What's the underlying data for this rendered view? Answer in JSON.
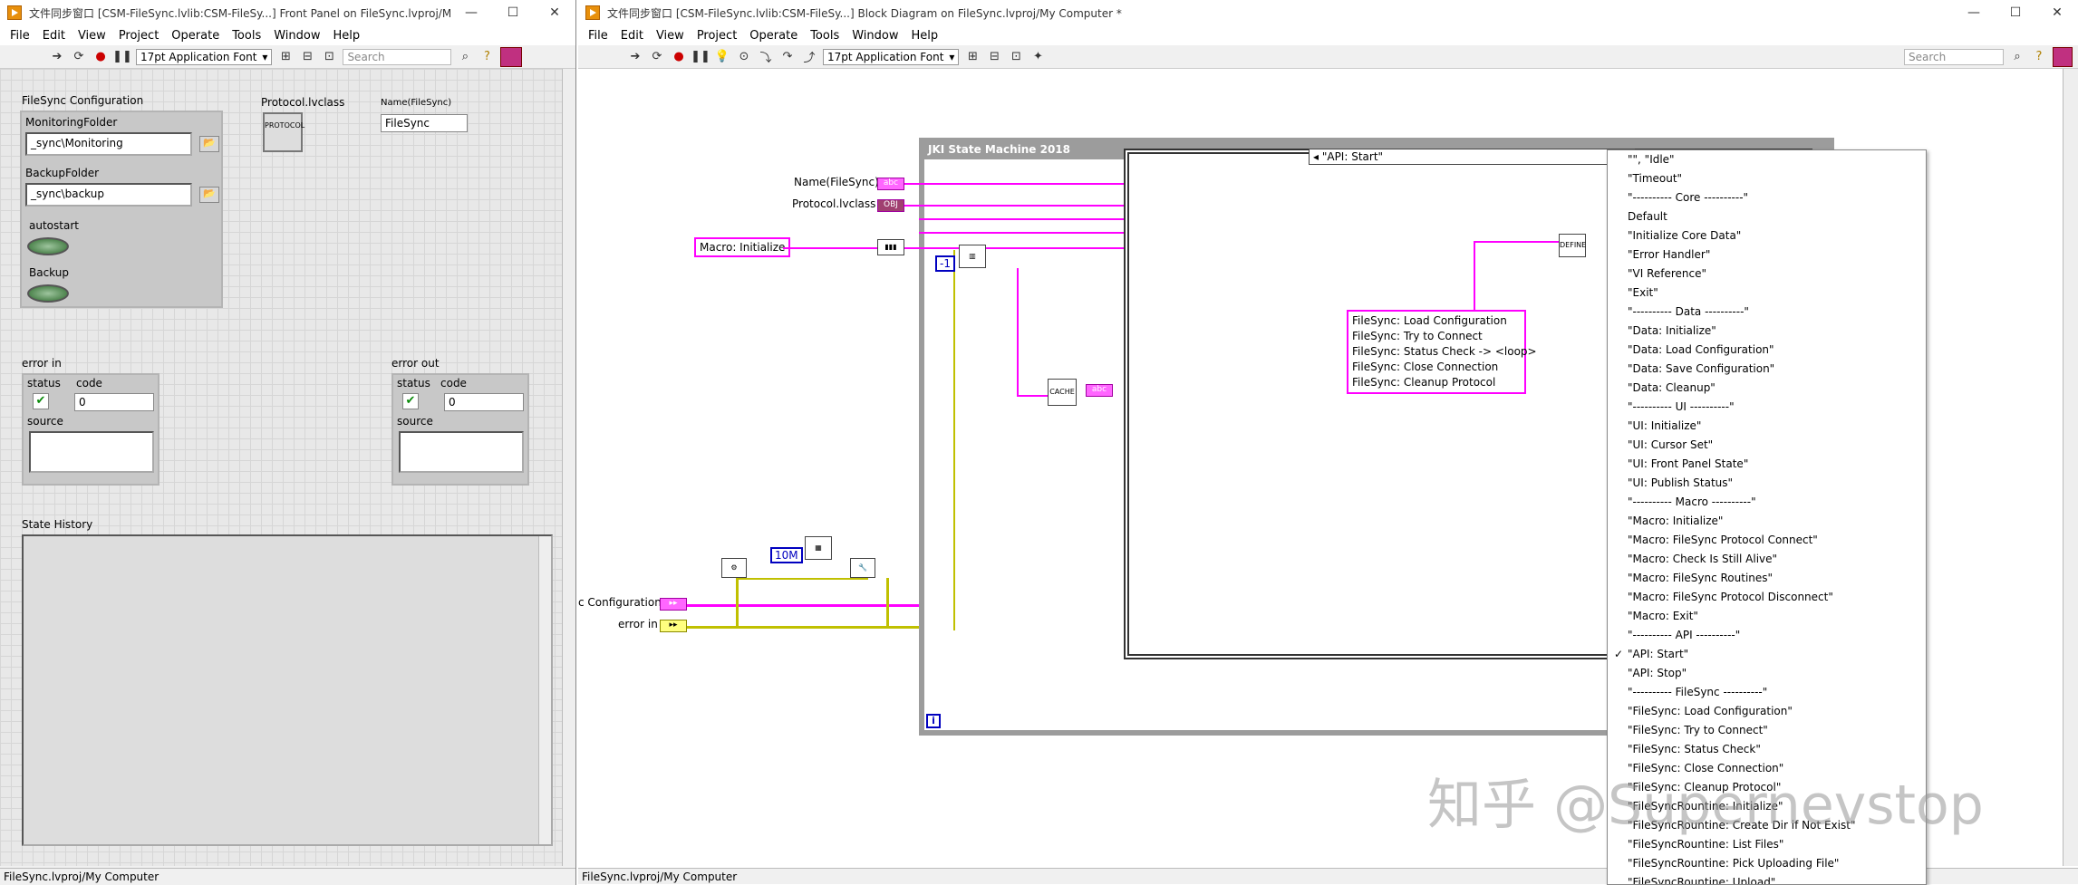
{
  "front_panel": {
    "title": "文件同步窗口 [CSM-FileSync.lvlib:CSM-FileSy...] Front Panel on FileSync.lvproj/M...",
    "menu": [
      "File",
      "Edit",
      "View",
      "Project",
      "Operate",
      "Tools",
      "Window",
      "Help"
    ],
    "font": "17pt Application Font",
    "search_placeholder": "Search",
    "config_label": "FileSync Configuration",
    "monitoring_label": "MonitoringFolder",
    "monitoring_value": "_sync\\Monitoring",
    "backup_label": "BackupFolder",
    "backup_value": "_sync\\backup",
    "autostart_label": "autostart",
    "backup_bool_label": "Backup",
    "protocol_label": "Protocol.lvclass",
    "protocol_icon_text": "PROTOCOL",
    "name_label": "Name(FileSync)",
    "name_value": "FileSync",
    "error_in": {
      "label": "error in",
      "status": "status",
      "code_label": "code",
      "code": "0",
      "source": "source"
    },
    "error_out": {
      "label": "error out",
      "status": "status",
      "code_label": "code",
      "code": "0",
      "source": "source"
    },
    "history_label": "State History",
    "status_path": "FileSync.lvproj/My Computer"
  },
  "block_diagram": {
    "title": "文件同步窗口 [CSM-FileSync.lvlib:CSM-FileSy...] Block Diagram on FileSync.lvproj/My Computer *",
    "menu": [
      "File",
      "Edit",
      "View",
      "Project",
      "Operate",
      "Tools",
      "Window",
      "Help"
    ],
    "font": "17pt Application Font",
    "search_placeholder": "Search",
    "sm_title": "JKI State Machine 2018",
    "name_ctrl": "Name(FileSync)",
    "protocol_ctrl": "Protocol.lvclass",
    "macro_const": "Macro: Initialize",
    "config_label": "c Configuration",
    "error_in_label": "error in",
    "case_selector": "\"API: Start\"",
    "neg_one": "-1",
    "ten_m": "10M",
    "define_text": "DEFINE",
    "cache_text": "CACHE",
    "iter": "i",
    "script_lines": [
      "FileSync: Load Configuration",
      "FileSync: Try to Connect",
      "FileSync: Status Check -> <loop>",
      "FileSync: Close Connection",
      "FileSync: Cleanup Protocol"
    ],
    "status_path": "FileSync.lvproj/My Computer"
  },
  "case_list": {
    "selected": "\"API: Start\"",
    "items": [
      "\"\", \"Idle\"",
      "\"Timeout\"",
      "\"---------- Core ----------\"",
      "Default",
      "\"Initialize Core Data\"",
      "\"Error Handler\"",
      "\"VI Reference\"",
      "\"Exit\"",
      "\"---------- Data ----------\"",
      "\"Data: Initialize\"",
      "\"Data: Load Configuration\"",
      "\"Data: Save Configuration\"",
      "\"Data: Cleanup\"",
      "\"---------- UI ----------\"",
      "\"UI: Initialize\"",
      "\"UI: Cursor Set\"",
      "\"UI: Front Panel State\"",
      "\"UI: Publish Status\"",
      "\"---------- Macro ----------\"",
      "\"Macro: Initialize\"",
      "\"Macro: FileSync Protocol Connect\"",
      "\"Macro: Check Is Still Alive\"",
      "\"Macro: FileSync Routines\"",
      "\"Macro: FileSync Protocol Disconnect\"",
      "\"Macro: Exit\"",
      "\"---------- API ----------\"",
      "\"API: Start\"",
      "\"API: Stop\"",
      "\"---------- FileSync ----------\"",
      "\"FileSync: Load Configuration\"",
      "\"FileSync: Try to Connect\"",
      "\"FileSync: Status Check\"",
      "\"FileSync: Close Connection\"",
      "\"FileSync: Cleanup Protocol\"",
      "\"FileSyncRountine: Initialize\"",
      "\"FileSyncRountine: Create Dir if Not Exist\"",
      "\"FileSyncRountine: List Files\"",
      "\"FileSyncRountine: Pick Uploading File\"",
      "\"FileSyncRountine: Upload\""
    ]
  },
  "watermark": "知乎 @Supernevstop",
  "colors": {
    "wire_string": "#ff00ff",
    "wire_error": "#c0c000",
    "sm_frame": "#9c9c9c"
  }
}
